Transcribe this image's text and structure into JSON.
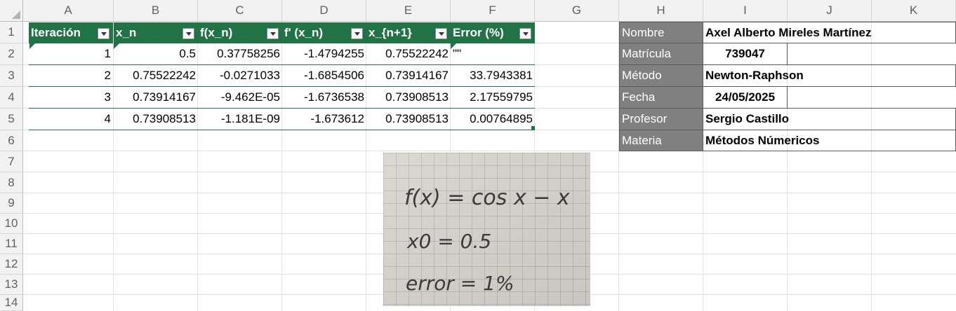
{
  "columns": [
    "A",
    "B",
    "C",
    "D",
    "E",
    "F",
    "G",
    "H",
    "I",
    "J",
    "K"
  ],
  "rows": [
    "1",
    "2",
    "3",
    "4",
    "5",
    "6",
    "7",
    "8",
    "9",
    "10",
    "11",
    "12",
    "13",
    "14"
  ],
  "table": {
    "headers": [
      "Iteración",
      "x_n",
      "f(x_n)",
      "f' (x_n)",
      "x_{n+1}",
      "Error (%)"
    ],
    "data": [
      [
        "1",
        "0.5",
        "0.37758256",
        "-1.4794255",
        "0.75522242",
        "\"\""
      ],
      [
        "2",
        "0.75522242",
        "-0.0271033",
        "-1.6854506",
        "0.73914167",
        "33.7943381"
      ],
      [
        "3",
        "0.73914167",
        "-9.462E-05",
        "-1.6736538",
        "0.73908513",
        "2.17559795"
      ],
      [
        "4",
        "0.73908513",
        "-1.181E-09",
        "-1.673612",
        "0.73908513",
        "0.00764895"
      ]
    ]
  },
  "info": [
    {
      "label": "Nombre",
      "value": "Axel Alberto Mireles Martínez"
    },
    {
      "label": "Matrícula",
      "value": "739047"
    },
    {
      "label": "Método",
      "value": "Newton-Raphson"
    },
    {
      "label": "Fecha",
      "value": "24/05/2025"
    },
    {
      "label": "Profesor",
      "value": "Sergio Castillo"
    },
    {
      "label": "Materia",
      "value": "Métodos Númericos"
    }
  ],
  "photo": {
    "lines": [
      "f(x) = cos x − x",
      "x0 = 0.5",
      "error = 1%"
    ]
  },
  "colors": {
    "table_header": "#217346",
    "info_label": "#808080",
    "grid": "#e1e1e1",
    "header_bg": "#f2f2f2"
  }
}
